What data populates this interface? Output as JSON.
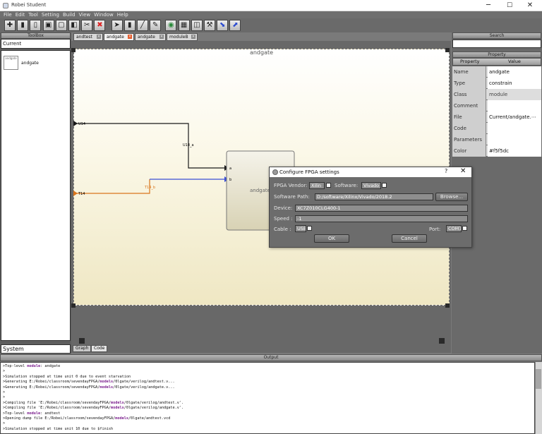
{
  "window": {
    "title": "Robei Student",
    "minimize": "─",
    "maximize": "☐",
    "close": "✕"
  },
  "menu": [
    "File",
    "Edit",
    "Tool",
    "Setting",
    "Build",
    "View",
    "Window",
    "Help"
  ],
  "toolbar": [
    {
      "name": "add-icon",
      "glyph": "✚"
    },
    {
      "name": "open-file-icon",
      "glyph": "▮"
    },
    {
      "name": "copy-file-icon",
      "glyph": "▯"
    },
    {
      "name": "save-icon",
      "glyph": "▣"
    },
    {
      "name": "new-page-icon",
      "glyph": "▢"
    },
    {
      "name": "paste-icon",
      "glyph": "◧"
    },
    {
      "name": "cut-icon",
      "glyph": "✂"
    },
    {
      "name": "delete-icon",
      "glyph": "✖"
    },
    {
      "name": "select-arrow-icon",
      "glyph": "➤"
    },
    {
      "name": "block-icon",
      "glyph": "▮"
    },
    {
      "name": "wire-icon",
      "glyph": "╱"
    },
    {
      "name": "pen-icon",
      "glyph": "✎"
    },
    {
      "name": "run-icon",
      "glyph": "◉"
    },
    {
      "name": "waveform-icon",
      "glyph": "▦"
    },
    {
      "name": "zoom-icon",
      "glyph": "◫"
    },
    {
      "name": "tool-icon",
      "glyph": "⚒"
    },
    {
      "name": "download-icon",
      "glyph": "⬊"
    },
    {
      "name": "fpga-icon",
      "glyph": "⬈"
    }
  ],
  "toolbox": {
    "header": "ToolBox",
    "input": "Current",
    "item_label": "andgate",
    "thumb_text": "andgate",
    "system": "System"
  },
  "tabs": [
    "andtest",
    "andgate",
    "andgate",
    "moduleB"
  ],
  "canvas": {
    "title": "andgate",
    "block_label": "andgate",
    "port_a": "a",
    "port_b": "b",
    "pin1": "U14",
    "pin2": "T14",
    "net1": "U14_a",
    "net2": "T14_b"
  },
  "bottom_tabs": [
    "Graph",
    "Code"
  ],
  "search_header": "Search",
  "property": {
    "header": "Property",
    "col_property": "Property",
    "col_value": "Value",
    "rows": [
      {
        "k": "Name",
        "v": "andgate"
      },
      {
        "k": "Type",
        "v": "constrain"
      },
      {
        "k": "Class",
        "v": "module"
      },
      {
        "k": "Comment",
        "v": ""
      },
      {
        "k": "File",
        "v": "Current/andgate.⋯"
      },
      {
        "k": "Code",
        "v": ""
      },
      {
        "k": "Parameters",
        "v": ""
      },
      {
        "k": "Color",
        "v": "#f5f5dc"
      }
    ]
  },
  "output": {
    "header": "Output",
    "lines": [
      [
        ">Top-level ",
        {
          "kw": "module"
        },
        ":  andgate"
      ],
      [
        ">"
      ],
      [
        ">Simulation stopped at time unit 0 due to event starvation"
      ],
      [
        ">Generating E:/Robei/classroom/sevendayFPGA/",
        {
          "kw": "models"
        },
        "/0lgate/verilog/andtest.v..."
      ],
      [
        ">Generating E:/Robei/classroom/sevendayFPGA/",
        {
          "kw": "models"
        },
        "/0lgate/verilog/andgate.v..."
      ],
      [
        ">"
      ],
      [
        ">"
      ],
      [
        ">Compiling file 'E:/Robei/classroom/sevendayFPGA/",
        {
          "kw": "models"
        },
        "/0lgate/verilog/andtest.v'."
      ],
      [
        ">Compiling file 'E:/Robei/classroom/sevendayFPGA/",
        {
          "kw": "models"
        },
        "/0lgate/verilog/andgate.v'."
      ],
      [
        ">Top-level ",
        {
          "kw": "module"
        },
        ":  andtest"
      ],
      [
        ">Opening dump file E:/Robei/classroom/sevendayFPGA/",
        {
          "kw": "models"
        },
        "/0lgate/andtest.vcd"
      ],
      [
        ">"
      ],
      [
        ">Simulation stopped at time unit 10 due to $finish"
      ]
    ]
  },
  "dialog": {
    "title": "Configure FPGA settings",
    "help": "?",
    "close": "✕",
    "vendor_label": "FPGA Vendor:",
    "vendor": "Xilin",
    "software_label": "Software:",
    "software": "Vivado",
    "path_label": "Software Path:",
    "path": "D:/software/Xilinx/Vivado/2018.2",
    "browse": "Browse...",
    "device_label": "Device:",
    "device": "XC7Z010CLG400-1",
    "speed_label": "Speed :",
    "speed": "-1",
    "cable_label": "Cable :",
    "cable": "USB",
    "port_label": "Port:",
    "port": "COM1",
    "ok": "OK",
    "cancel": "Cancel"
  },
  "colors": {
    "wire_black": "#1a1a1a",
    "wire_orange": "#d9751c",
    "wire_blue": "#3b4fd6",
    "close_tab": "#e45a2a"
  }
}
